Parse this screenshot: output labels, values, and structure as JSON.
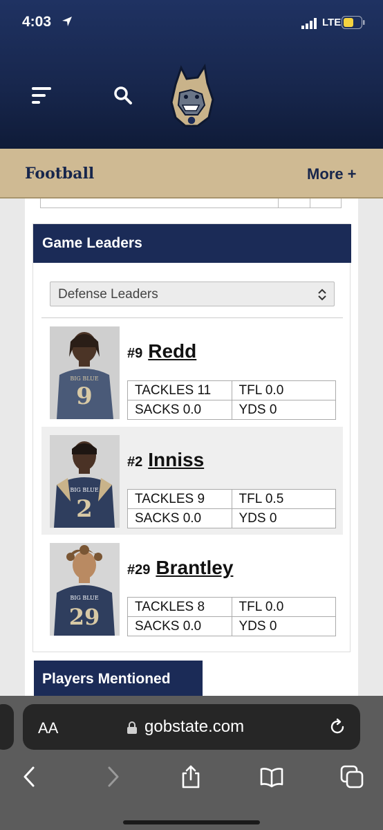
{
  "status_bar": {
    "time": "4:03",
    "network": "LTE"
  },
  "header": {
    "sport": "Football",
    "more": "More +"
  },
  "game_leaders": {
    "title": "Game Leaders",
    "selected": "Defense Leaders",
    "players": [
      {
        "number": "#9",
        "name": "Redd",
        "tackles": "TACKLES 11",
        "tfl": "TFL 0.0",
        "sacks": "SACKS 0.0",
        "yds": "YDS 0",
        "jersey": "9"
      },
      {
        "number": "#2",
        "name": "Inniss",
        "tackles": "TACKLES 9",
        "tfl": "TFL 0.5",
        "sacks": "SACKS 0.0",
        "yds": "YDS 0",
        "jersey": "2"
      },
      {
        "number": "#29",
        "name": "Brantley",
        "tackles": "TACKLES 8",
        "tfl": "TFL 0.0",
        "sacks": "SACKS 0.0",
        "yds": "YDS 0",
        "jersey": "29"
      }
    ],
    "jersey_text": "BIG BLUE"
  },
  "players_mentioned": "Players Mentioned",
  "browser": {
    "aa": "AA",
    "url": "gobstate.com"
  },
  "colors": {
    "navy": "#1b2b57",
    "gold": "#cfba93"
  }
}
